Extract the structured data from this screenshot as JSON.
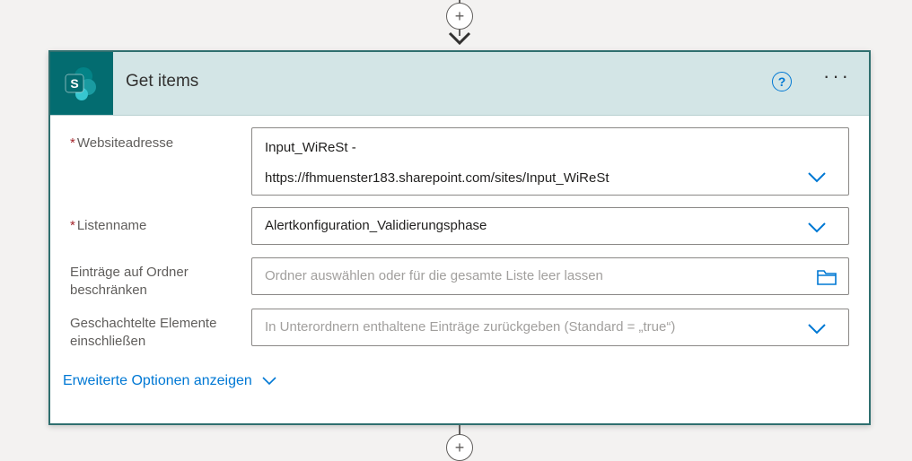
{
  "card": {
    "title": "Get items",
    "app_icon_letter": "S",
    "help_label": "?",
    "more_label": "···"
  },
  "fields": {
    "site_address": {
      "label": "Websiteadresse",
      "required": "*",
      "value_line1": "Input_WiReSt -",
      "value_line2": "https://fhmuenster183.sharepoint.com/sites/Input_WiReSt"
    },
    "list_name": {
      "label": "Listenname",
      "required": "*",
      "value": "Alertkonfiguration_Validierungsphase"
    },
    "folder": {
      "label_line1": "Einträge auf Ordner",
      "label_line2": "beschränken",
      "placeholder": "Ordner auswählen oder für die gesamte Liste leer lassen"
    },
    "nested": {
      "label_line1": "Geschachtelte Elemente",
      "label_line2": "einschließen",
      "placeholder": "In Unterordnern enthaltene Einträge zurückgeben (Standard = „true“)"
    }
  },
  "advanced_options": {
    "label": "Erweiterte Optionen anzeigen"
  },
  "icons": {
    "app": "sharepoint-icon",
    "dropdown": "chevron-down-icon",
    "folder": "folder-icon",
    "add": "plus-icon"
  },
  "colors": {
    "accent": "#0078d4",
    "header_bg": "#d3e5e6",
    "card_border": "#2f6f6f",
    "sharepoint": "#036c70",
    "required": "#a4262c"
  }
}
